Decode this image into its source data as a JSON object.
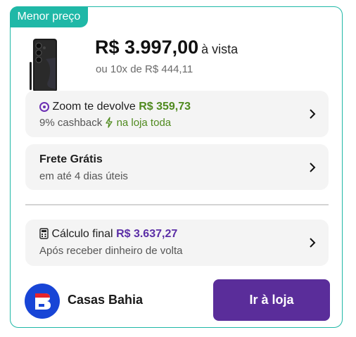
{
  "badge": "Menor preço",
  "price": {
    "value": "R$ 3.997,00",
    "suffix": "à vista",
    "installments": "ou 10x de R$ 444,11"
  },
  "cashback": {
    "label": "Zoom te devolve",
    "amount": "R$ 359,73",
    "percent_text": "9% cashback",
    "scope_text": "na loja toda",
    "icon": "zoom-logo-icon",
    "scope_icon": "lightning-icon"
  },
  "shipping": {
    "title": "Frete Grátis",
    "subtitle": "em até 4 dias úteis"
  },
  "final_calc": {
    "label": "Cálculo final",
    "amount": "R$ 3.637,27",
    "subtitle": "Após receber dinheiro de volta",
    "icon": "calculator-icon"
  },
  "store": {
    "name": "Casas Bahia",
    "logo": "casas-bahia-logo",
    "button_label": "Ir à loja"
  },
  "colors": {
    "accent": "#1fb8a7",
    "purple": "#5a2d9a",
    "green": "#4f8a1e",
    "store_blue": "#1845d6"
  }
}
